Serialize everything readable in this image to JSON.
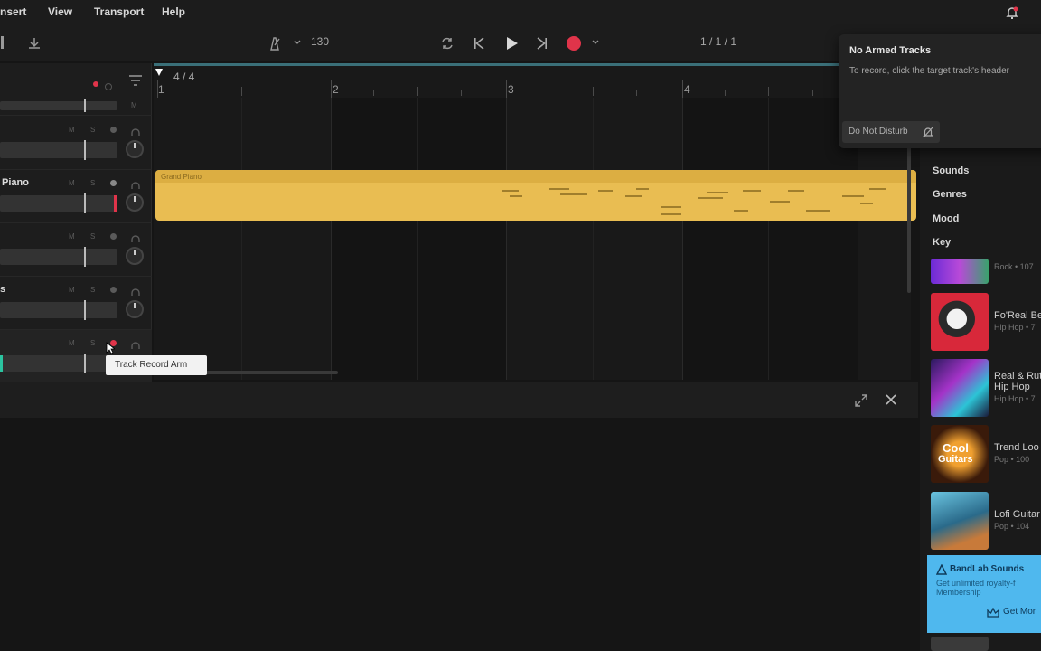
{
  "menu": {
    "insert": "nsert",
    "view": "View",
    "transport": "Transport",
    "help": "Help"
  },
  "toolbar": {
    "bpm": "130",
    "position": "1 / 1 / 1"
  },
  "tracks": {
    "time_signature": "4 / 4",
    "t1_name": "",
    "t2_name": "Piano",
    "t3_name": "",
    "t4_name": "s",
    "t5_name": ""
  },
  "ruler": {
    "m1": "1",
    "m2": "2",
    "m3": "3",
    "m4": "4"
  },
  "clip": {
    "label": "Grand Piano"
  },
  "tooltip": {
    "text": "Track Record Arm"
  },
  "popup": {
    "title": "No Armed Tracks",
    "body": "To record, click the target track's header",
    "dnd_label": "Do Not Disturb"
  },
  "sidebar": {
    "filters": [
      "Sounds",
      "Genres",
      "Mood",
      "Key"
    ],
    "packs": [
      {
        "title": "",
        "sub": "Rock • 107"
      },
      {
        "title": "Fo'Real Be",
        "sub": "Hip Hop • 7"
      },
      {
        "title": "Real & Rut",
        "title2": "Hip Hop",
        "sub": "Hip Hop • 7"
      },
      {
        "title": "Trend Loo",
        "sub": "Pop • 100"
      },
      {
        "title": "Lofi Guitar",
        "sub": "Pop • 104"
      }
    ],
    "thumb_text": {
      "cool": "Cool",
      "guitars": "Guitars"
    },
    "promo": {
      "title": "BandLab Sounds",
      "line1": "Get unlimited royalty-f",
      "line2": "Membership",
      "cta": "Get Mor"
    }
  },
  "colors": {
    "accent_red": "#e0344a",
    "clip_yellow": "#e9bd52",
    "promo_blue": "#4fb8ee"
  }
}
